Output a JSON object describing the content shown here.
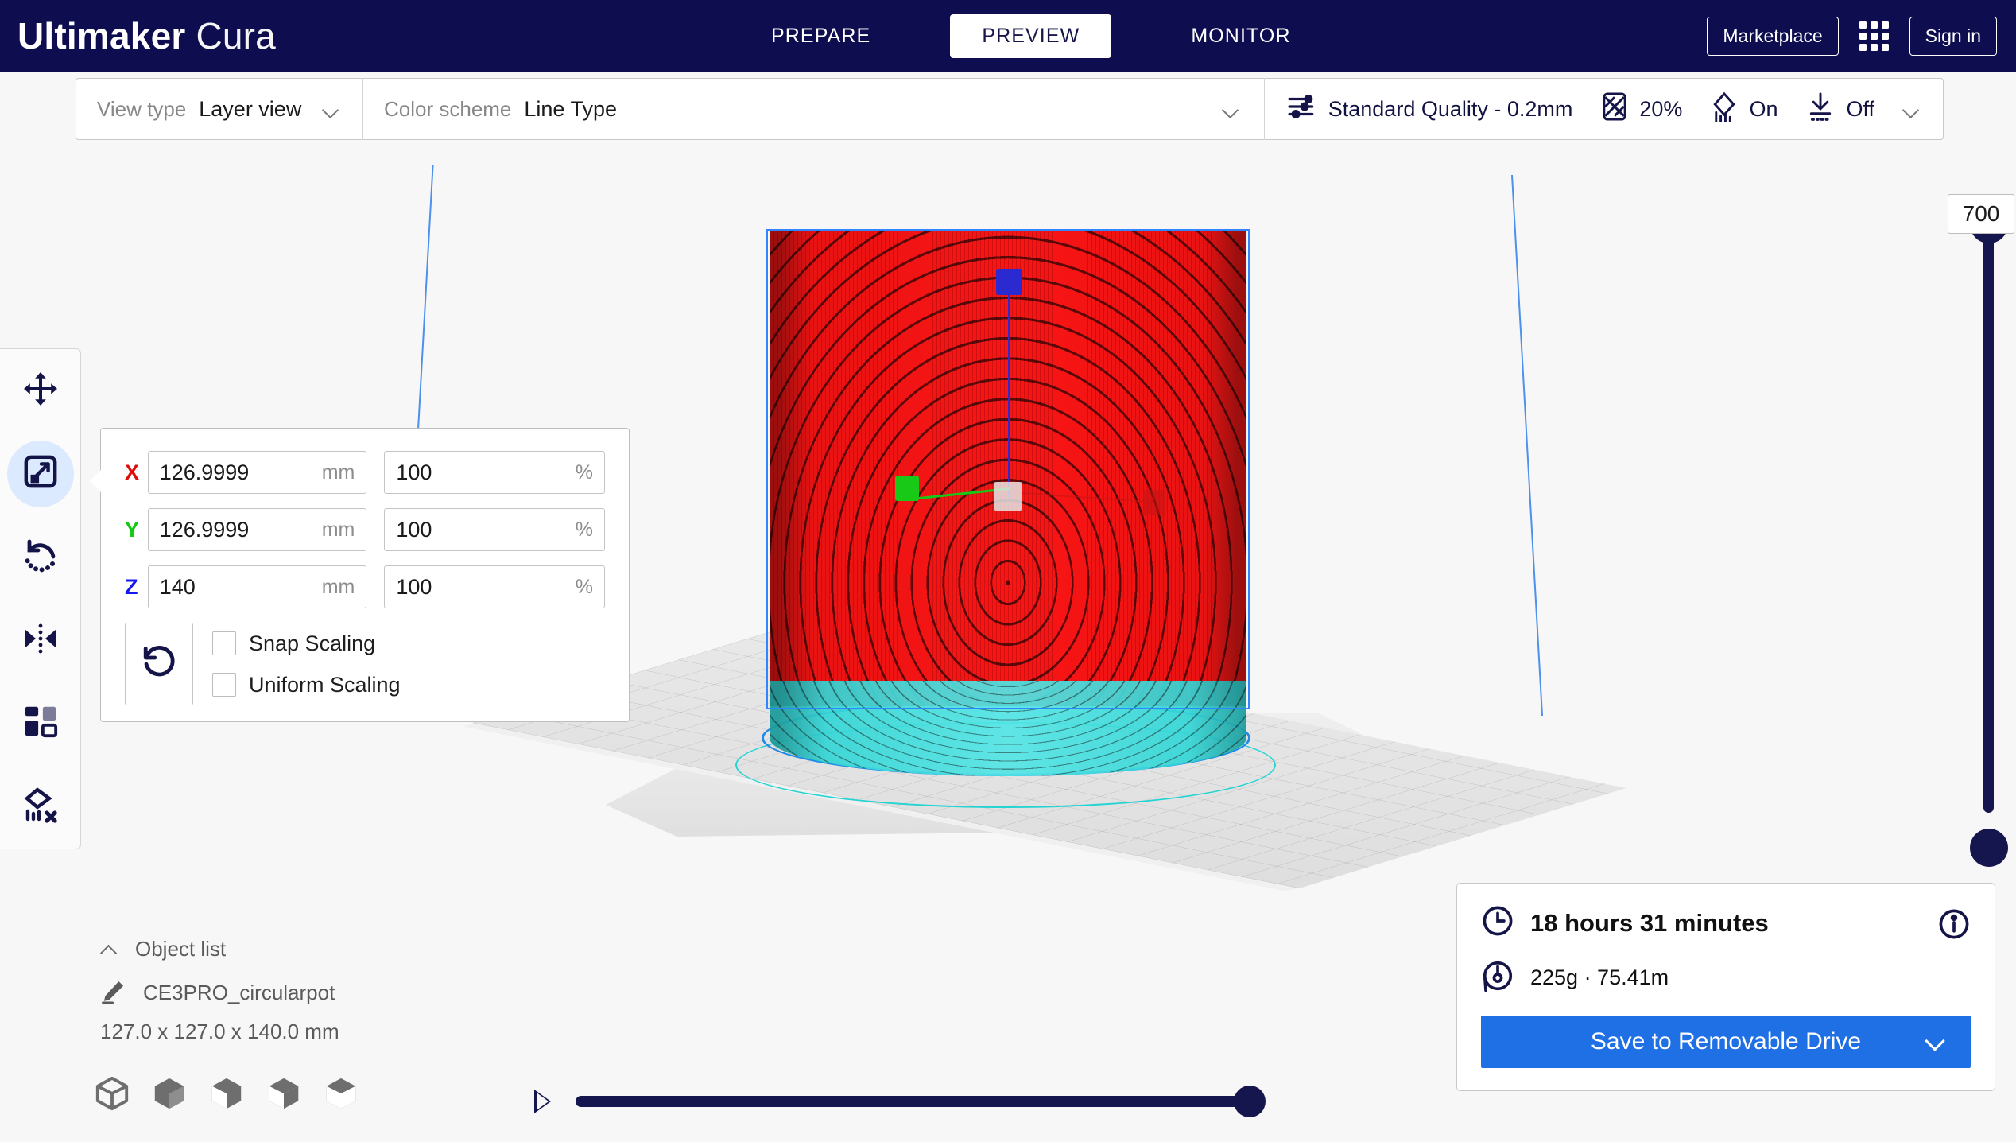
{
  "app": {
    "brand_bold": "Ultimaker",
    "brand_light": "Cura",
    "header_bg": "#0d0d4f",
    "accent_blue": "#1f6fe5"
  },
  "header": {
    "tabs": [
      {
        "label": "PREPARE",
        "active": false
      },
      {
        "label": "PREVIEW",
        "active": true
      },
      {
        "label": "MONITOR",
        "active": false
      }
    ],
    "marketplace_label": "Marketplace",
    "signin_label": "Sign in",
    "apps_icon": "grid-apps-icon"
  },
  "toolbar": {
    "view_type_label": "View type",
    "view_type_value": "Layer view",
    "color_scheme_label": "Color scheme",
    "color_scheme_value": "Line Type",
    "quality_profile": "Standard Quality - 0.2mm",
    "infill_value": "20%",
    "support_value": "On",
    "adhesion_value": "Off",
    "icons": {
      "settings": "sliders-icon",
      "infill": "infill-icon",
      "support": "support-icon",
      "adhesion": "adhesion-icon",
      "chevron": "chevron-down-icon"
    }
  },
  "tools": [
    {
      "name": "move-tool",
      "icon": "move-arrows-icon",
      "active": false
    },
    {
      "name": "scale-tool",
      "icon": "scale-icon",
      "active": true
    },
    {
      "name": "rotate-tool",
      "icon": "rotate-icon",
      "active": false
    },
    {
      "name": "mirror-tool",
      "icon": "mirror-icon",
      "active": false
    },
    {
      "name": "per-model-settings-tool",
      "icon": "per-model-settings-icon",
      "active": false
    },
    {
      "name": "support-blocker-tool",
      "icon": "support-blocker-icon",
      "active": false
    }
  ],
  "scale_panel": {
    "axes": [
      {
        "axis": "X",
        "color": "#e00b0b",
        "mm": "126.9999",
        "percent": "100"
      },
      {
        "axis": "Y",
        "color": "#10cc10",
        "mm": "126.9999",
        "percent": "100"
      },
      {
        "axis": "Z",
        "color": "#1616ee",
        "mm": "140",
        "percent": "100"
      }
    ],
    "unit_mm": "mm",
    "unit_percent": "%",
    "reset_icon": "reset-arrow-icon",
    "snap_scaling_label": "Snap Scaling",
    "snap_scaling_checked": false,
    "uniform_scaling_label": "Uniform Scaling",
    "uniform_scaling_checked": false
  },
  "object_list": {
    "title": "Object list",
    "caret_icon": "chevron-up-icon",
    "item_icon": "pencil-icon",
    "item_name": "CE3PRO_circularpot",
    "dimensions": "127.0 x 127.0 x 140.0 mm"
  },
  "camera_views": [
    {
      "name": "view-3d",
      "icon": "cube-wireframe-icon"
    },
    {
      "name": "view-front",
      "icon": "cube-front-icon"
    },
    {
      "name": "view-top",
      "icon": "cube-top-icon"
    },
    {
      "name": "view-left",
      "icon": "cube-left-icon"
    },
    {
      "name": "view-right",
      "icon": "cube-right-icon"
    }
  ],
  "playback": {
    "play_icon": "play-icon",
    "simulation_value": 100
  },
  "layer_slider": {
    "value": "700",
    "top_handle_icon": "slider-handle-top",
    "bottom_handle_icon": "slider-handle-bottom"
  },
  "print_info": {
    "time_icon": "clock-icon",
    "time": "18 hours 31 minutes",
    "material_icon": "spool-icon",
    "material": "225g · 75.41m",
    "info_icon": "info-icon",
    "save_label": "Save to Removable Drive",
    "save_chevron_icon": "chevron-down-icon"
  },
  "viewport": {
    "model_color": "#fb1414",
    "bottom_color": "#35d6d6",
    "skirt_color": "#25d3d3",
    "bbox_color": "#2f86ff",
    "gizmo": {
      "x_handle_color": "#c41515",
      "y_handle_color": "#18c918",
      "z_handle_color": "#2a2ad0",
      "center_handle_color": "#e4e4e4"
    }
  }
}
